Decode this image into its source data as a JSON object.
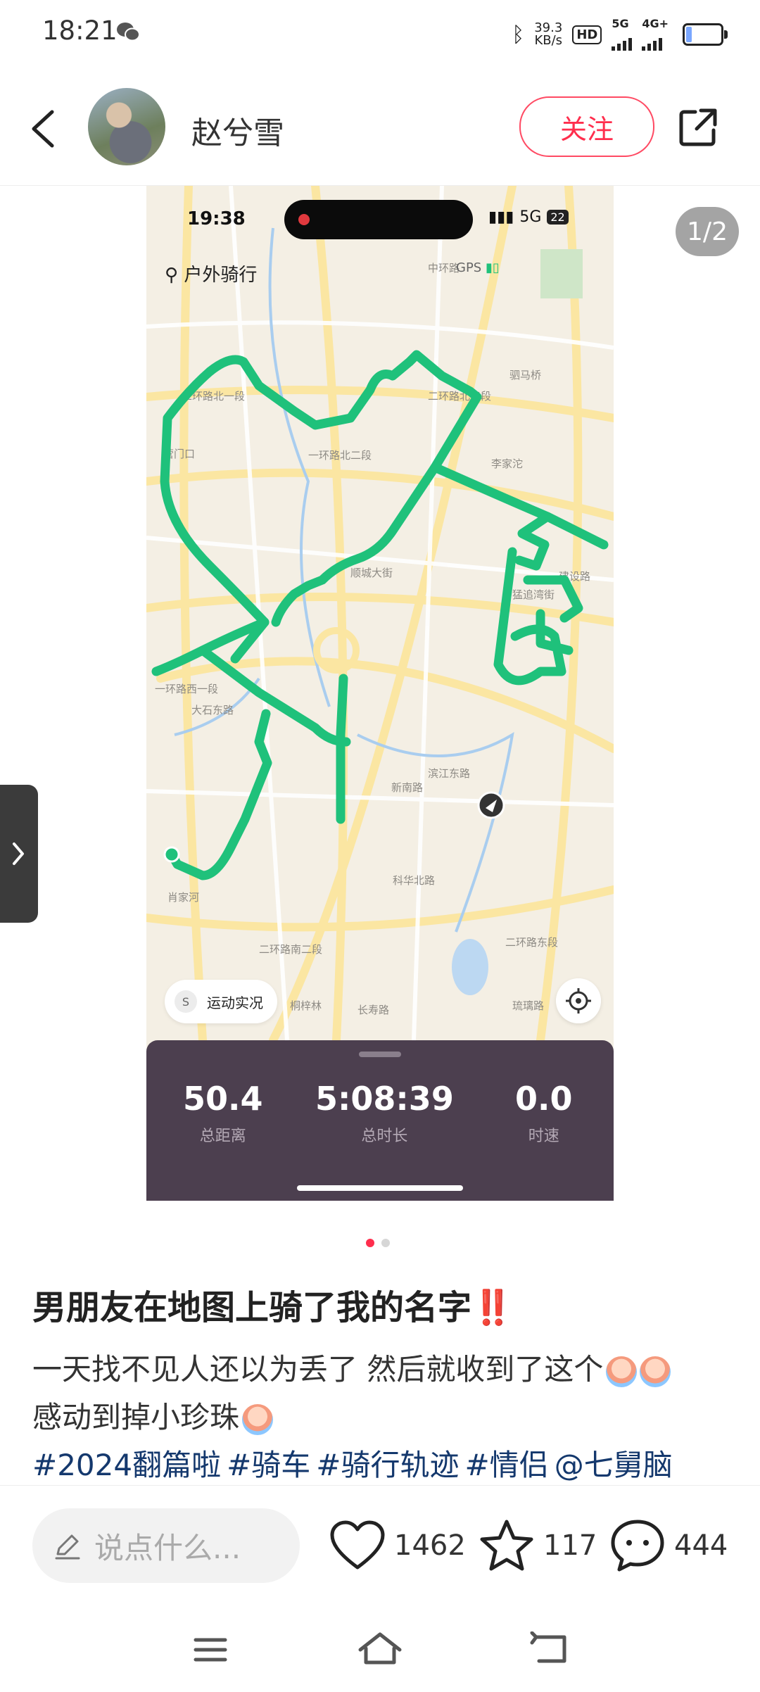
{
  "status_bar": {
    "time": "18:21",
    "net_speed_value": "39.3",
    "net_speed_unit": "KB/s",
    "hd": "HD",
    "sig1": "5G",
    "sig2": "4G+"
  },
  "header": {
    "author": "赵兮雪",
    "follow_label": "关注"
  },
  "image": {
    "pager": "1/2",
    "phone_time": "19:38",
    "phone_network": "5G",
    "phone_battery": "22",
    "mode": "户外骑行",
    "gps": "GPS",
    "live_status": "运动实况",
    "chip_letter": "S",
    "map_labels": {
      "ring_north_1": "二环路北一段",
      "ring_north_2": "一环路北二段",
      "ring_north_3": "二环路北三段",
      "ring_east": "二环路东段",
      "ring_south": "二环路南二段",
      "ring_west": "一环路西一段",
      "yingmenkou": "营门口",
      "lijiatuo": "李家沱",
      "xiaomaqiao": "驷马桥",
      "zhonghuan": "中环路",
      "dashi": "大石东路",
      "xiaojiahe": "肖家河",
      "shuncheng": "顺城大街",
      "xinnan": "新南路",
      "kehua": "科华北路",
      "tongzilin": "桐梓林",
      "changshou": "长寿路",
      "mengzhui": "猛追湾街",
      "jiangshe": "建设路",
      "binjiang": "滨江东路",
      "shabanqiao": "琉璃路"
    },
    "stats": [
      {
        "value": "50.4",
        "label": "总距离"
      },
      {
        "value": "5:08:39",
        "label": "总时长"
      },
      {
        "value": "0.0",
        "label": "时速"
      }
    ],
    "route_color": "#1fc17b"
  },
  "post": {
    "title": "男朋友在地图上骑了我的名字",
    "title_mark": "‼️",
    "body_line1": "一天找不见人还以为丢了 然后就收到了这个",
    "body_line2": "感动到掉小珍珠",
    "tags": [
      "#2024翻篇啦",
      "#骑车",
      "#骑行轨迹",
      "#情侣",
      "@七舅脑"
    ]
  },
  "bottom_bar": {
    "comment_placeholder": "说点什么...",
    "likes": "1462",
    "collects": "117",
    "comments": "444"
  },
  "colors": {
    "accent": "#ff2e4d",
    "tag": "#14386d",
    "panel": "#4c3f4f"
  }
}
